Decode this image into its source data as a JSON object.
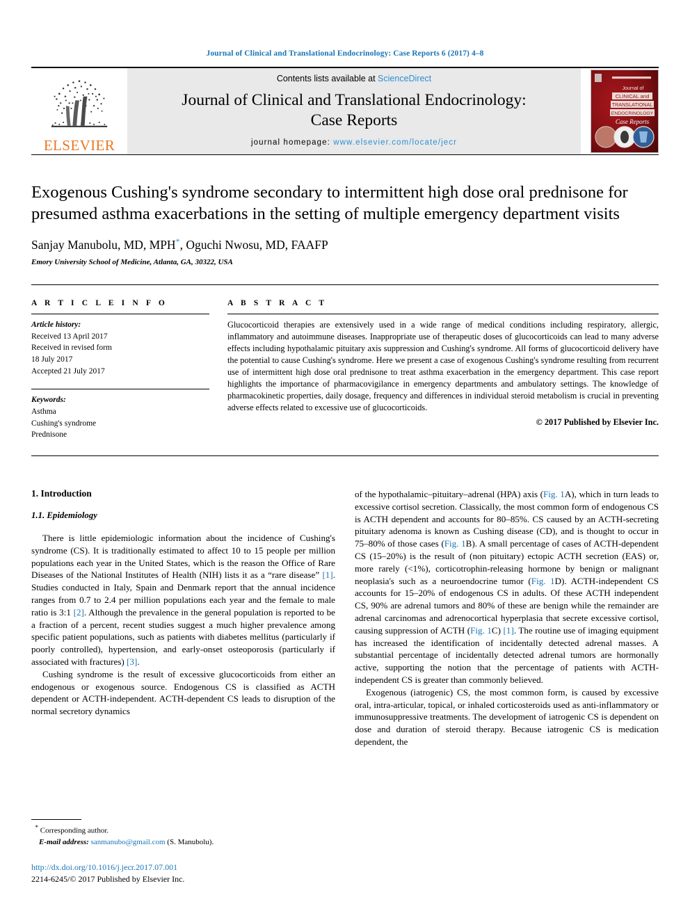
{
  "running_head": "Journal of Clinical and Translational Endocrinology: Case Reports 6 (2017) 4–8",
  "masthead": {
    "publisher_name": "ELSEVIER",
    "contents_prefix": "Contents lists available at ",
    "contents_link": "ScienceDirect",
    "journal_title_line1": "Journal of Clinical and Translational Endocrinology:",
    "journal_title_line2": "Case Reports",
    "homepage_label": "journal homepage: ",
    "homepage_url": "www.elsevier.com/locate/jecr",
    "cover": {
      "line1": "Journal of",
      "line2": "CLINICAL and",
      "line3": "TRANSLATIONAL",
      "line4": "ENDOCRINOLOGY",
      "line5": "Case Reports"
    }
  },
  "article": {
    "title": "Exogenous Cushing's syndrome secondary to intermittent high dose oral prednisone for presumed asthma exacerbations in the setting of multiple emergency department visits",
    "authors": "Sanjay Manubolu, MD, MPH",
    "authors_rest": ", Oguchi Nwosu, MD, FAAFP",
    "corresponding_marker": "*",
    "affiliation": "Emory University School of Medicine, Atlanta, GA, 30322, USA"
  },
  "article_info": {
    "heading": "A R T I C L E  I N F O",
    "history_label": "Article history:",
    "history": [
      "Received 13 April 2017",
      "Received in revised form",
      "18 July 2017",
      "Accepted 21 July 2017"
    ],
    "keywords_label": "Keywords:",
    "keywords": [
      "Asthma",
      "Cushing's syndrome",
      "Prednisone"
    ]
  },
  "abstract": {
    "heading": "A B S T R A C T",
    "text": "Glucocorticoid therapies are extensively used in a wide range of medical conditions including respiratory, allergic, inflammatory and autoimmune diseases. Inappropriate use of therapeutic doses of glucocorticoids can lead to many adverse effects including hypothalamic pituitary axis suppression and Cushing's syndrome. All forms of glucocorticoid delivery have the potential to cause Cushing's syndrome. Here we present a case of exogenous Cushing's syndrome resulting from recurrent use of intermittent high dose oral prednisone to treat asthma exacerbation in the emergency department. This case report highlights the importance of pharmacovigilance in emergency departments and ambulatory settings. The knowledge of pharmacokinetic properties, daily dosage, frequency and differences in individual steroid metabolism is crucial in preventing adverse effects related to excessive use of glucocorticoids.",
    "copyright": "© 2017 Published by Elsevier Inc."
  },
  "body": {
    "section_heading": "1. Introduction",
    "subsection_heading": "1.1. Epidemiology",
    "left_para_1_a": "There is little epidemiologic information about the incidence of Cushing's syndrome (CS). It is traditionally estimated to affect 10 to 15 people per million populations each year in the United States, which is the reason the Office of Rare Diseases of the National Institutes of Health (NIH) lists it as a “rare disease” ",
    "left_ref_1": "[1]",
    "left_para_1_b": ". Studies conducted in Italy, Spain and Denmark report that the annual incidence ranges from 0.7 to 2.4 per million populations each year and the female to male ratio is 3:1 ",
    "left_ref_2": "[2]",
    "left_para_1_c": ". Although the prevalence in the general population is reported to be a fraction of a percent, recent studies suggest a much higher prevalence among specific patient populations, such as patients with diabetes mellitus (particularly if poorly controlled), hypertension, and early-onset osteoporosis (particularly if associated with fractures) ",
    "left_ref_3": "[3]",
    "left_para_1_d": ".",
    "left_para_2": "Cushing syndrome is the result of excessive glucocorticoids from either an endogenous or exogenous source. Endogenous CS is classified as ACTH dependent or ACTH-independent. ACTH-dependent CS leads to disruption of the normal secretory dynamics",
    "right_para_1_a": "of the hypothalamic–pituitary–adrenal (HPA) axis (",
    "right_ref_fig1a": "Fig. 1",
    "right_para_1_b": "A), which in turn leads to excessive cortisol secretion. Classically, the most common form of endogenous CS is ACTH dependent and accounts for 80–85%. CS caused by an ACTH-secreting pituitary adenoma is known as Cushing disease (CD), and is thought to occur in 75–80% of those cases (",
    "right_ref_fig1b": "Fig. 1",
    "right_para_1_c": "B). A small percentage of cases of ACTH-dependent CS (15–20%) is the result of (non pituitary) ectopic ACTH secretion (EAS) or, more rarely (<1%), corticotrophin-releasing hormone by benign or malignant neoplasia's such as a neuroendocrine tumor (",
    "right_ref_fig1d": "Fig. 1",
    "right_para_1_d": "D). ACTH-independent CS accounts for 15–20% of endogenous CS in adults. Of these ACTH independent CS, 90% are adrenal tumors and 80% of these are benign while the remainder are adrenal carcinomas and adrenocortical hyperplasia that secrete excessive cortisol, causing suppression of ACTH (",
    "right_ref_fig1c": "Fig. 1",
    "right_para_1_e": "C) ",
    "right_ref_1": "[1]",
    "right_para_1_f": ". The routine use of imaging equipment has increased the identification of incidentally detected adrenal masses. A substantial percentage of incidentally detected adrenal tumors are hormonally active, supporting the notion that the percentage of patients with ACTH-independent CS is greater than commonly believed.",
    "right_para_2": "Exogenous (iatrogenic) CS, the most common form, is caused by excessive oral, intra-articular, topical, or inhaled corticosteroids used as anti-inflammatory or immunosuppressive treatments. The development of iatrogenic CS is dependent on dose and duration of steroid therapy. Because iatrogenic CS is medication dependent, the"
  },
  "footer": {
    "corresponding_star": "*",
    "corresponding_label": "Corresponding author.",
    "email_label": "E-mail address:",
    "email": "sanmanubo@gmail.com",
    "email_suffix": "(S. Manubolu).",
    "doi": "http://dx.doi.org/10.1016/j.jecr.2017.07.001",
    "issn_line": "2214-6245/© 2017 Published by Elsevier Inc."
  },
  "colors": {
    "link_blue": "#1a76b5",
    "sd_blue": "#2b8fd6",
    "elsevier_orange": "#E87722",
    "cover_red": "#7b0f12"
  }
}
